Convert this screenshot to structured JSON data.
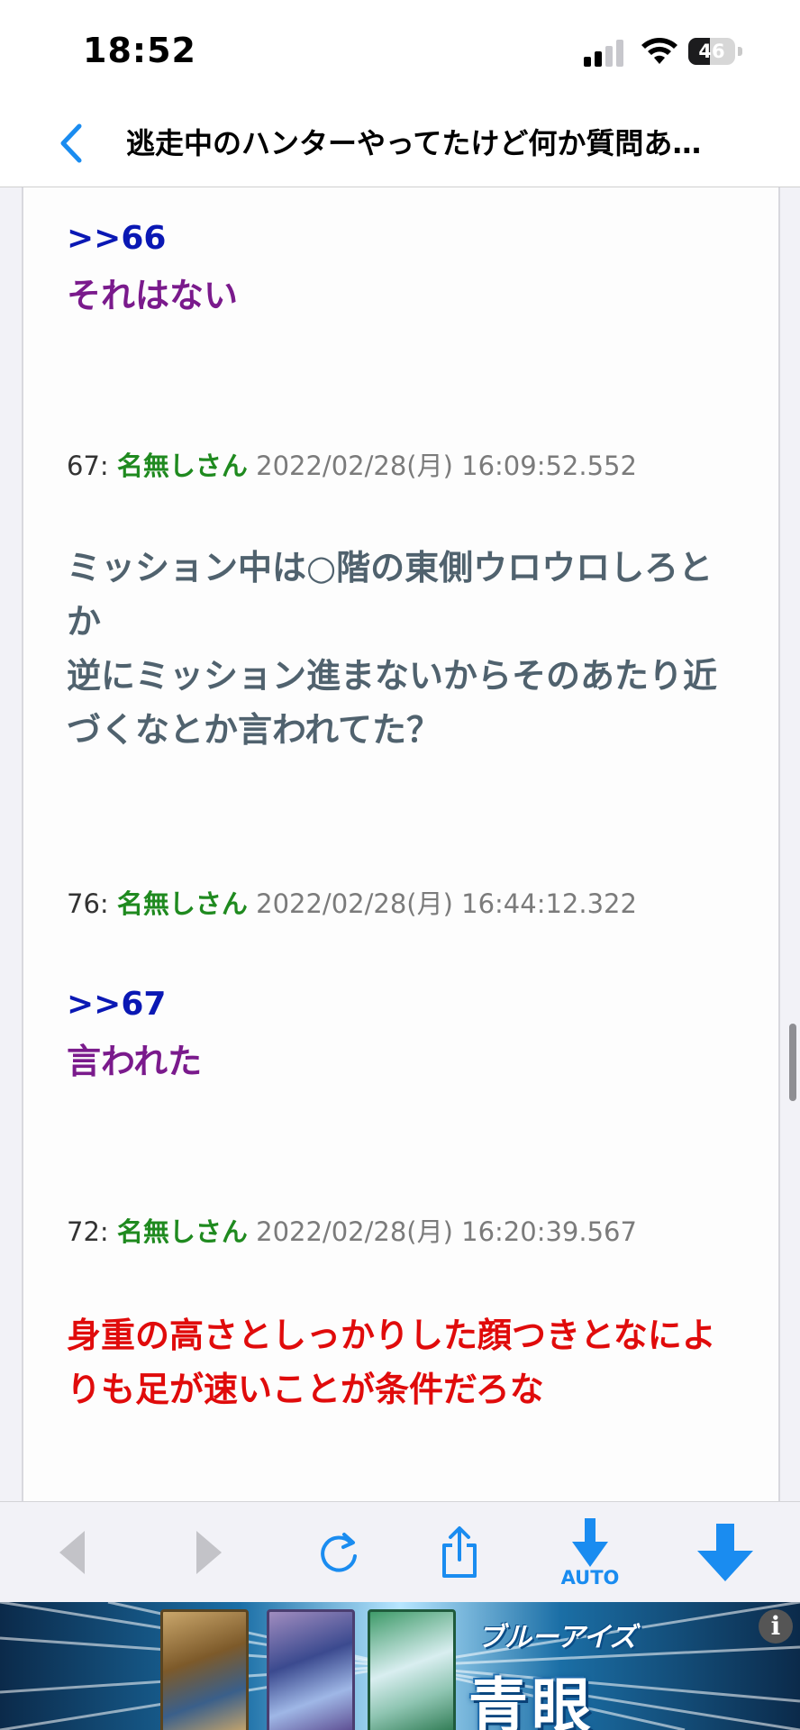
{
  "status_bar": {
    "time": "18:52",
    "battery": "46",
    "battery_level": 0.46
  },
  "nav": {
    "title": "逃走中のハンターやってたけど何か質問あ…"
  },
  "posts": [
    {
      "anchor": ">>66",
      "text": "それはない",
      "color": "#7a1a8c"
    },
    {
      "number": "67:",
      "name": "名無しさん",
      "datetime": "2022/02/28(月) 16:09:52.552",
      "text_lines": [
        "ミッション中は○階の東側ウロウロしろと",
        "か",
        "逆にミッション進まないからそのあたり近",
        "づくなとか言われてた？"
      ],
      "color": "#50626e"
    },
    {
      "number": "76:",
      "name": "名無しさん",
      "datetime": "2022/02/28(月) 16:44:12.322",
      "anchor": ">>67",
      "text": "言われた",
      "color": "#7a1a8c"
    },
    {
      "number": "72:",
      "name": "名無しさん",
      "datetime": "2022/02/28(月) 16:20:39.567",
      "text_lines": [
        "身重の高さとしっかりした顔つきとなによ",
        "りも足が速いことが条件だろな"
      ],
      "color": "#e00b0b"
    }
  ],
  "toolbar": {
    "auto_label": "AUTO",
    "icons": [
      "triangle-back-icon",
      "triangle-forward-icon",
      "refresh-icon",
      "share-icon",
      "auto-scroll-down-icon",
      "scroll-down-icon"
    ]
  },
  "ad": {
    "subtitle": "ブルーアイズ",
    "title": "青眼",
    "info": "i"
  },
  "colors": {
    "accent": "#1a8cf0",
    "anchor": "#0a18b4",
    "name": "#1f8a1f"
  }
}
